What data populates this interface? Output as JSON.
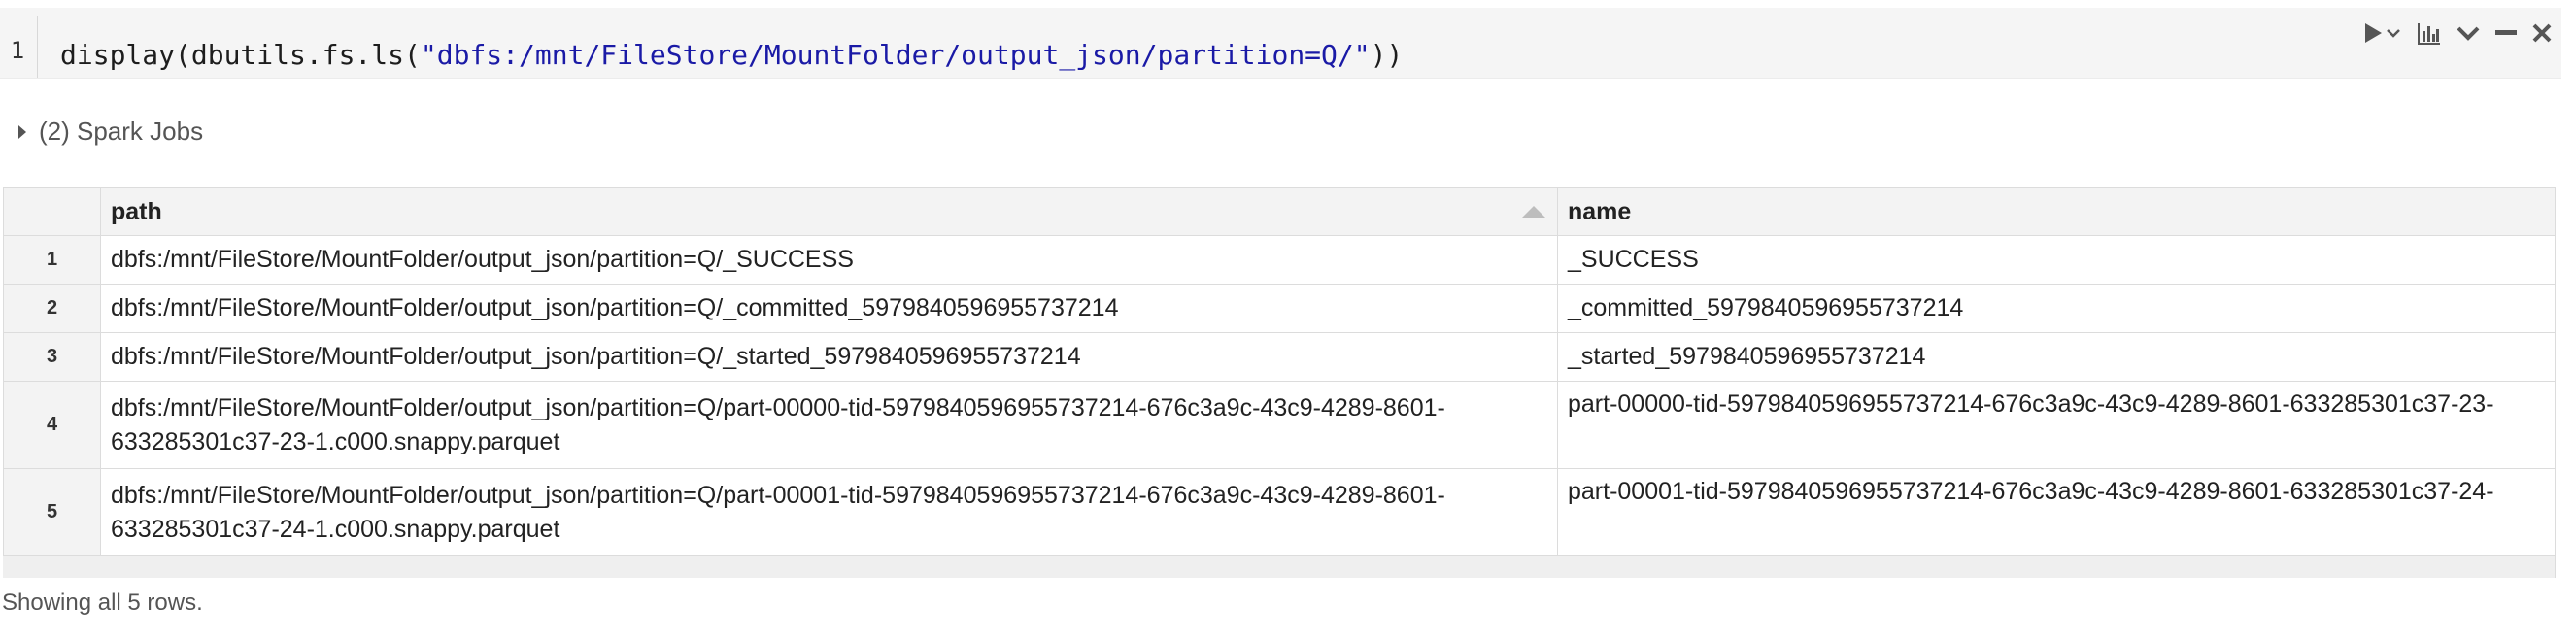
{
  "cell": {
    "line_number": "1",
    "code_prefix": "display(dbutils.fs.ls(",
    "code_string": "\"dbfs:/mnt/FileStore/MountFolder/output_json/partition=Q/\"",
    "code_suffix": "))"
  },
  "toolbar": {
    "icons": [
      "run-icon",
      "run-dropdown-icon",
      "chart-icon",
      "collapse-icon",
      "minimize-icon",
      "close-icon"
    ]
  },
  "spark_jobs": {
    "label": "(2) Spark Jobs"
  },
  "table": {
    "columns": [
      "path",
      "name"
    ],
    "sorted_column": "path",
    "rows": [
      {
        "index": "1",
        "path": "dbfs:/mnt/FileStore/MountFolder/output_json/partition=Q/_SUCCESS",
        "name": "_SUCCESS"
      },
      {
        "index": "2",
        "path": "dbfs:/mnt/FileStore/MountFolder/output_json/partition=Q/_committed_5979840596955737214",
        "name": "_committed_5979840596955737214"
      },
      {
        "index": "3",
        "path": "dbfs:/mnt/FileStore/MountFolder/output_json/partition=Q/_started_5979840596955737214",
        "name": "_started_5979840596955737214"
      },
      {
        "index": "4",
        "path_line1": "dbfs:/mnt/FileStore/MountFolder/output_json/partition=Q/part-00000-tid-5979840596955737214-676c3a9c-43c9-4289-8601-",
        "path_line2": "633285301c37-23-1.c000.snappy.parquet",
        "name": "part-00000-tid-5979840596955737214-676c3a9c-43c9-4289-8601-633285301c37-23-"
      },
      {
        "index": "5",
        "path_line1": "dbfs:/mnt/FileStore/MountFolder/output_json/partition=Q/part-00001-tid-5979840596955737214-676c3a9c-43c9-4289-8601-",
        "path_line2": "633285301c37-24-1.c000.snappy.parquet",
        "name": "part-00001-tid-5979840596955737214-676c3a9c-43c9-4289-8601-633285301c37-24-"
      }
    ]
  },
  "footer": {
    "text": "Showing all 5 rows."
  },
  "colors": {
    "string": "#1a1aa6",
    "cell_bg": "#f5f5f5",
    "header_bg": "#f3f3f3",
    "border": "#dcdcdc"
  }
}
